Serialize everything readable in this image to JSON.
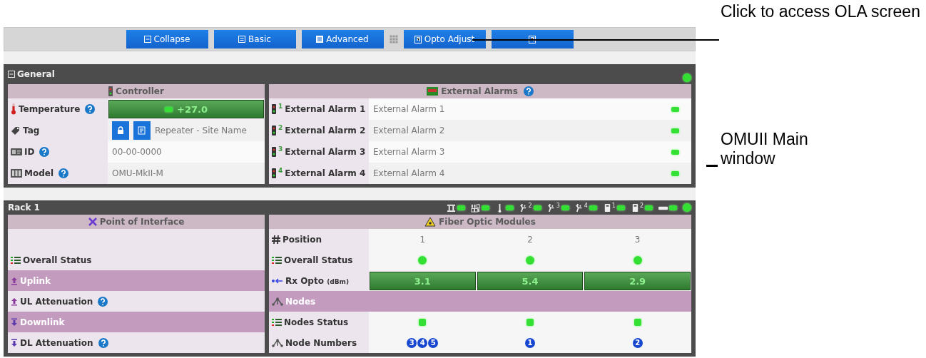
{
  "toolbar": {
    "items": [
      {
        "kind": "button",
        "label": "Collapse"
      },
      {
        "kind": "button",
        "label": "Basic"
      },
      {
        "kind": "button",
        "label": "Advanced"
      },
      {
        "kind": "grip"
      },
      {
        "kind": "button",
        "label": "Opto Adjust"
      },
      {
        "kind": "button"
      }
    ]
  },
  "general": {
    "title": "General",
    "ok": true,
    "controller": {
      "title": "Controller",
      "rows": [
        {
          "kind": "meter",
          "label": "Temperature",
          "help": true,
          "value": "+27.0",
          "ok": true
        },
        {
          "kind": "tag",
          "label": "Tag",
          "help": false,
          "value": "Repeater - Site Name"
        },
        {
          "kind": "text",
          "label": "ID",
          "help": true,
          "value": "00-00-0000"
        },
        {
          "kind": "text",
          "label": "Model",
          "help": true,
          "value": "OMU-MkII-M"
        }
      ]
    },
    "alarms": {
      "title": "External Alarms",
      "help": true,
      "rows": [
        {
          "index": "1",
          "label": "External Alarm 1",
          "value": "External Alarm 1",
          "ok": true
        },
        {
          "index": "2",
          "label": "External Alarm 2",
          "value": "External Alarm 2",
          "ok": true
        },
        {
          "index": "3",
          "label": "External Alarm 3",
          "value": "External Alarm 3",
          "ok": true
        },
        {
          "index": "4",
          "label": "External Alarm 4",
          "value": "External Alarm 4",
          "ok": true
        }
      ]
    }
  },
  "rack": {
    "title": "Rack 1",
    "ok": true,
    "indicators": [
      {
        "kind": "io",
        "ok": true
      },
      {
        "kind": "binary",
        "ok": true
      },
      {
        "kind": "thermometer",
        "ok": true
      },
      {
        "kind": "plug",
        "sup": "2",
        "ok": true
      },
      {
        "kind": "plug",
        "sup": "3",
        "ok": true
      },
      {
        "kind": "plug",
        "sup": "4",
        "ok": true
      },
      {
        "kind": "module",
        "sup": "1",
        "ok": true
      },
      {
        "kind": "module",
        "sup": "2",
        "ok": true
      },
      {
        "kind": "bar",
        "ok": true
      }
    ],
    "poi": {
      "title": "Point of Interface",
      "rows": [
        {
          "kind": "blank"
        },
        {
          "kind": "plain",
          "label": "Overall Status",
          "help": false
        },
        {
          "kind": "section",
          "label": "Uplink",
          "help": false
        },
        {
          "kind": "plain",
          "label": "UL Attenuation",
          "help": true
        },
        {
          "kind": "section",
          "label": "Downlink",
          "help": false
        },
        {
          "kind": "plain",
          "label": "DL Attenuation",
          "help": true
        }
      ]
    },
    "modules": {
      "title": "Fiber Optic Modules",
      "rows": [
        {
          "kind": "text",
          "label": "Position",
          "values": [
            "1",
            "2",
            "3"
          ]
        },
        {
          "kind": "dots",
          "label": "Overall Status",
          "ok": [
            true,
            true,
            true
          ]
        },
        {
          "kind": "meter",
          "label": "Rx Opto",
          "unit": "(dBm)",
          "values": [
            "3.1",
            "5.4",
            "2.9"
          ]
        },
        {
          "kind": "section",
          "label": "Nodes"
        },
        {
          "kind": "squares",
          "label": "Nodes Status",
          "ok": [
            true,
            true,
            true
          ]
        },
        {
          "kind": "badges",
          "label": "Node Numbers",
          "values": [
            [
              "3",
              "4",
              "5"
            ],
            [
              "1"
            ],
            [
              "2"
            ]
          ]
        }
      ]
    }
  },
  "annotations": [
    {
      "text": "Click to access OLA screen"
    },
    {
      "text": "OMUII Main window"
    }
  ]
}
